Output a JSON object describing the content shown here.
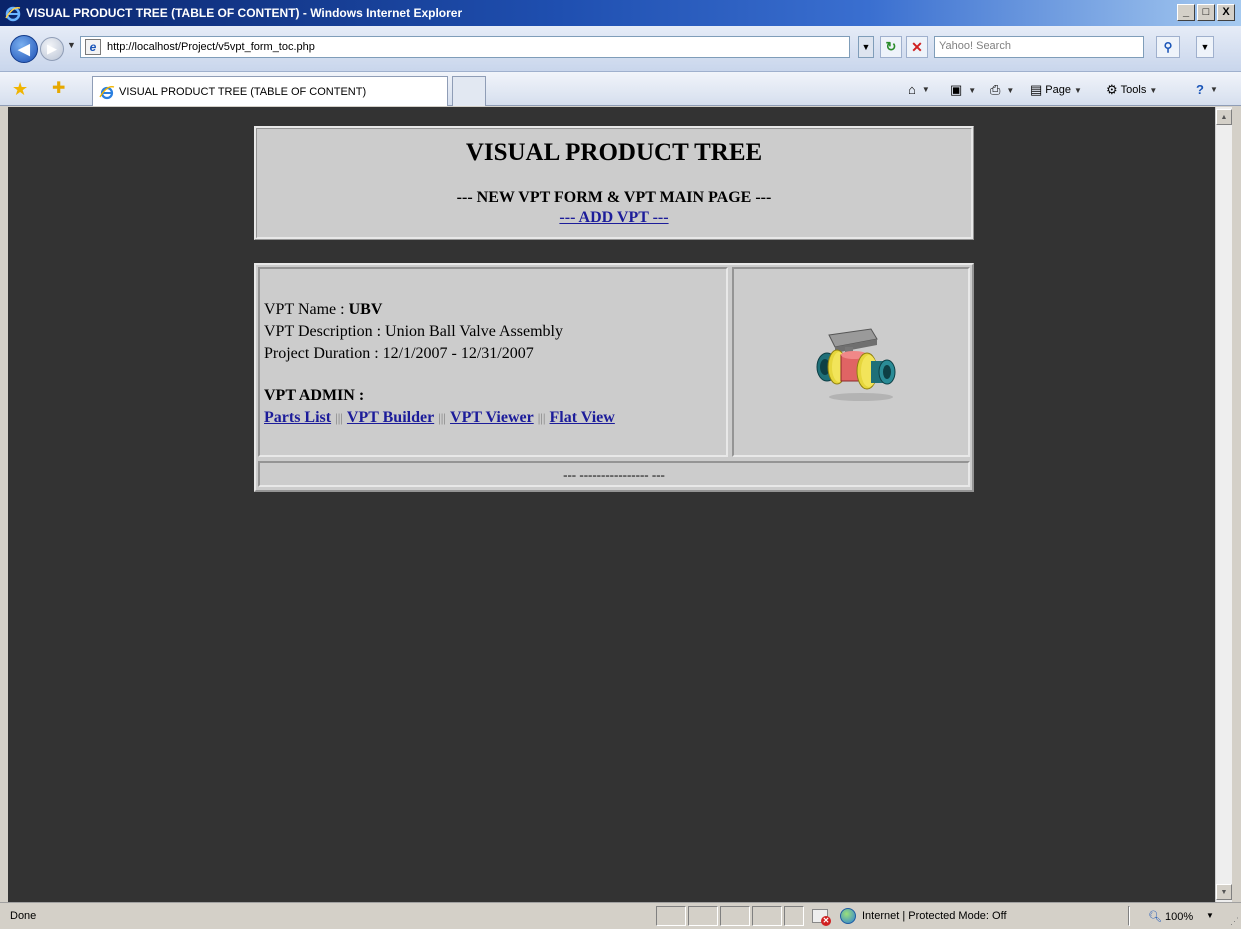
{
  "window": {
    "title": "VISUAL PRODUCT TREE (TABLE OF CONTENT) - Windows Internet Explorer",
    "buttons": [
      "_",
      "□",
      "X"
    ]
  },
  "address_bar": {
    "url": "http://localhost/Project/v5vpt_form_toc.php",
    "search_placeholder": "Yahoo! Search"
  },
  "tab": {
    "label": "VISUAL PRODUCT TREE (TABLE OF CONTENT)"
  },
  "command_bar": {
    "page_label": "Page",
    "tools_label": "Tools"
  },
  "page": {
    "heading": "VISUAL PRODUCT TREE",
    "subheading": "--- NEW VPT FORM & VPT MAIN PAGE ---",
    "add_link": "--- ADD VPT ---",
    "vpt_name_label": "VPT Name : ",
    "vpt_name_value": "UBV",
    "vpt_description": "VPT Description : Union Ball Valve Assembly",
    "project_duration": "Project Duration : 12/1/2007 - 12/31/2007",
    "admin_label": "VPT ADMIN :",
    "admin_links": [
      "Parts List",
      "VPT Builder",
      "VPT Viewer",
      "Flat View"
    ],
    "separator": "|||",
    "footer": "--- ---------------- ---",
    "image_icon": "union-ball-valve-image"
  },
  "status_bar": {
    "status": "Done",
    "zone": "Internet | Protected Mode: Off",
    "zoom": "100%"
  },
  "colors": {
    "page_background": "#333333",
    "panel_background": "#cccccc",
    "link": "#1c1c9a",
    "titlebar": "#0a246a"
  }
}
